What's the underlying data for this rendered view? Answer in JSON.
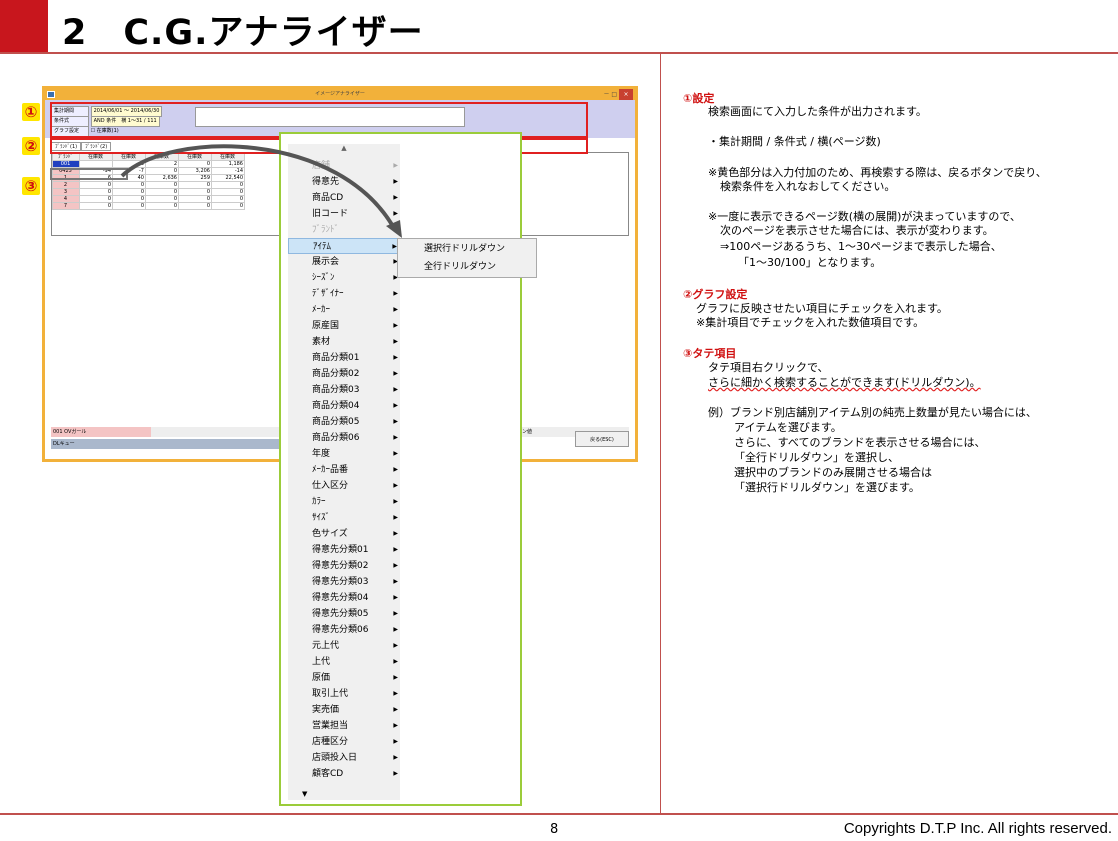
{
  "header": {
    "title": "2　C.G.アナライザー"
  },
  "footer": {
    "page": "8",
    "copyright": "Copyrights  D.T.P Inc. All rights reserved."
  },
  "app": {
    "window_title": "イメージアナライザー",
    "conditions": [
      {
        "label": "集計期間",
        "value": "2014/06/01 ～ 2014/06/30"
      },
      {
        "label": "条件式",
        "value": "AND 条件　横 1～31 / 111"
      },
      {
        "label": "グラフ設定",
        "value": "在庫数(1)"
      }
    ],
    "tabs": [
      "ﾌﾞﾗﾝﾄﾞ(1)",
      "ﾌﾞﾗﾝﾄﾞ(2)"
    ],
    "grid_header": [
      "ﾌﾞﾗﾝﾄﾞ",
      "在庫数",
      "在庫数",
      "在庫数",
      "在庫数",
      "在庫数"
    ],
    "grid_rows": [
      [
        "001",
        "",
        "0",
        "2",
        "0",
        "1,186"
      ],
      [
        "0425",
        "-94",
        "-7",
        "0",
        "3,206",
        "-14"
      ],
      [
        "1",
        "6",
        "40",
        "2,636",
        "259",
        "22,540"
      ],
      [
        "2",
        "0",
        "0",
        "0",
        "0",
        "0"
      ],
      [
        "3",
        "0",
        "0",
        "0",
        "0",
        "0"
      ],
      [
        "4",
        "0",
        "0",
        "0",
        "0",
        "0"
      ],
      [
        "7",
        "0",
        "0",
        "0",
        "0",
        "0"
      ]
    ],
    "status_left": "001 OVガール",
    "dl_queue": "DLキュー",
    "back_button": "戻る(ESC)",
    "status_right": "ウン値"
  },
  "markers": [
    "①",
    "②",
    "③"
  ],
  "context_menu": {
    "items": [
      {
        "label": "店舗",
        "disabled": true
      },
      {
        "label": "得意先",
        "disabled": false
      },
      {
        "label": "商品CD",
        "disabled": false
      },
      {
        "label": "旧コード",
        "disabled": false
      },
      {
        "label": "ﾌﾞﾗﾝﾄﾞ",
        "disabled": true
      },
      {
        "label": "ｱｲﾃﾑ",
        "disabled": false,
        "highlighted": true
      },
      {
        "label": "展示会",
        "disabled": false
      },
      {
        "label": "ｼｰｽﾞﾝ",
        "disabled": false
      },
      {
        "label": "ﾃﾞｻﾞｲﾅｰ",
        "disabled": false
      },
      {
        "label": "ﾒｰｶｰ",
        "disabled": false
      },
      {
        "label": "原産国",
        "disabled": false
      },
      {
        "label": "素材",
        "disabled": false
      },
      {
        "label": "商品分類01",
        "disabled": false
      },
      {
        "label": "商品分類02",
        "disabled": false
      },
      {
        "label": "商品分類03",
        "disabled": false
      },
      {
        "label": "商品分類04",
        "disabled": false
      },
      {
        "label": "商品分類05",
        "disabled": false
      },
      {
        "label": "商品分類06",
        "disabled": false
      },
      {
        "label": "年度",
        "disabled": false
      },
      {
        "label": "ﾒｰｶｰ品番",
        "disabled": false
      },
      {
        "label": "仕入区分",
        "disabled": false
      },
      {
        "label": "ｶﾗｰ",
        "disabled": false
      },
      {
        "label": "ｻｲｽﾞ",
        "disabled": false
      },
      {
        "label": "色サイズ",
        "disabled": false
      },
      {
        "label": "得意先分類01",
        "disabled": false
      },
      {
        "label": "得意先分類02",
        "disabled": false
      },
      {
        "label": "得意先分類03",
        "disabled": false
      },
      {
        "label": "得意先分類04",
        "disabled": false
      },
      {
        "label": "得意先分類05",
        "disabled": false
      },
      {
        "label": "得意先分類06",
        "disabled": false
      },
      {
        "label": "元上代",
        "disabled": false
      },
      {
        "label": "上代",
        "disabled": false
      },
      {
        "label": "原価",
        "disabled": false
      },
      {
        "label": "取引上代",
        "disabled": false
      },
      {
        "label": "実売価",
        "disabled": false
      },
      {
        "label": "営業担当",
        "disabled": false
      },
      {
        "label": "店種区分",
        "disabled": false
      },
      {
        "label": "店頭投入日",
        "disabled": false
      },
      {
        "label": "顧客CD",
        "disabled": false
      }
    ],
    "submenu": [
      "選択行ドリルダウン",
      "全行ドリルダウン"
    ]
  },
  "explanation": {
    "s1_title": "①設定",
    "s1_lines": [
      "検索画面にて入力した条件が出力されます。",
      "・集計期間 / 条件式 / 横(ページ数)",
      "※黄色部分は入力付加のため、再検索する際は、戻るボタンで戻り、",
      "検索条件を入れなおしてください。",
      "※一度に表示できるページ数(横の展開)が決まっていますので、",
      "次のページを表示させた場合には、表示が変わります。",
      "⇒100ページあるうち、1～30ページまで表示した場合、",
      "「1～30/100」となります。"
    ],
    "s2_title": "②グラフ設定",
    "s2_lines": [
      "グラフに反映させたい項目にチェックを入れます。",
      "※集計項目でチェックを入れた数値項目です。"
    ],
    "s3_title": "③タテ項目",
    "s3_lines": [
      "タテ項目右クリックで、",
      "さらに細かく検索することができます(ドリルダウン)。",
      "例）ブランド別店舗別アイテム別の純売上数量が見たい場合には、",
      "アイテムを選びます。",
      "さらに、すべてのブランドを表示させる場合には、",
      "「全行ドリルダウン」を選択し、",
      "選択中のブランドのみ展開させる場合は",
      "「選択行ドリルダウン」を選びます。"
    ]
  }
}
